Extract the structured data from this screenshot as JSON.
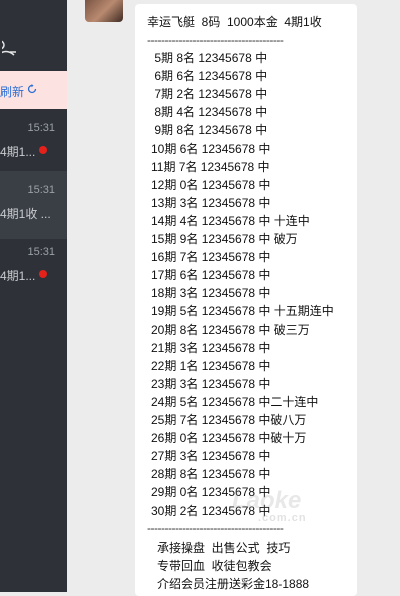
{
  "sidebar": {
    "refresh_label": "刷新",
    "chats": [
      {
        "time": "15:31",
        "preview": "4期1...",
        "unread": true
      },
      {
        "time": "15:31",
        "preview": "4期1收 ...",
        "unread": false
      },
      {
        "time": "15:31",
        "preview": "4期1...",
        "unread": true
      }
    ]
  },
  "message": {
    "header": "幸运飞艇  8码  1000本金  4期1收",
    "divider": "---------------------------------------",
    "rows": [
      " 5期 8名 12345678 中",
      " 6期 6名 12345678 中",
      " 7期 2名 12345678 中",
      " 8期 4名 12345678 中",
      " 9期 8名 12345678 中",
      "10期 6名 12345678 中",
      "11期 7名 12345678 中",
      "12期 0名 12345678 中",
      "13期 3名 12345678 中",
      "14期 4名 12345678 中 十连中",
      "15期 9名 12345678 中 破万",
      "16期 7名 12345678 中",
      "17期 6名 12345678 中",
      "18期 3名 12345678 中",
      "19期 5名 12345678 中 十五期连中",
      "20期 8名 12345678 中 破三万",
      "21期 3名 12345678 中",
      "22期 1名 12345678 中",
      "23期 3名 12345678 中",
      "24期 5名 12345678 中二十连中",
      "25期 7名 12345678 中破八万",
      "26期 0名 12345678 中破十万",
      "27期 3名 12345678 中",
      "28期 8名 12345678 中",
      "29期 0名 12345678 中",
      "30期 2名 12345678 中"
    ],
    "footer": [
      "承接操盘  出售公式  技巧",
      "专带回血  收徒包教会",
      "介绍会员注册送彩金18-1888"
    ]
  },
  "watermark": {
    "text": "Laoke",
    "sub": ".com.cn"
  }
}
